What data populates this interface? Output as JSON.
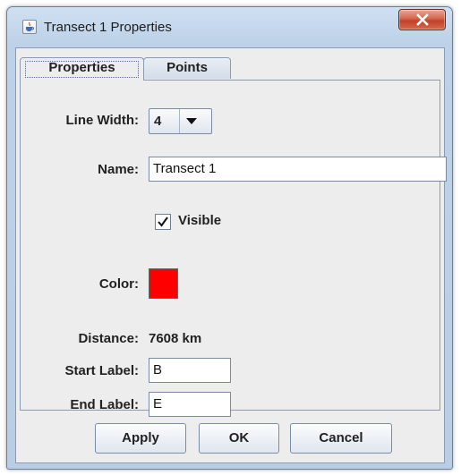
{
  "window": {
    "title": "Transect 1 Properties"
  },
  "icons": {
    "app": "java-cup-icon",
    "close": "close-x-icon",
    "dropdown": "triangle-down-icon",
    "check": "checkmark-icon"
  },
  "tabs": [
    {
      "label": "Properties",
      "selected": true
    },
    {
      "label": "Points",
      "selected": false
    }
  ],
  "form": {
    "line_width": {
      "label": "Line Width:",
      "value": "4"
    },
    "name": {
      "label": "Name:",
      "value": "Transect 1"
    },
    "visible": {
      "label": "Visible",
      "checked": true
    },
    "color": {
      "label": "Color:",
      "value": "#ff0000"
    },
    "distance": {
      "label": "Distance:",
      "value": "7608 km"
    },
    "start_label": {
      "label": "Start Label:",
      "value": "B"
    },
    "end_label": {
      "label": "End Label:",
      "value": "E"
    }
  },
  "buttons": {
    "apply": "Apply",
    "ok": "OK",
    "cancel": "Cancel"
  }
}
